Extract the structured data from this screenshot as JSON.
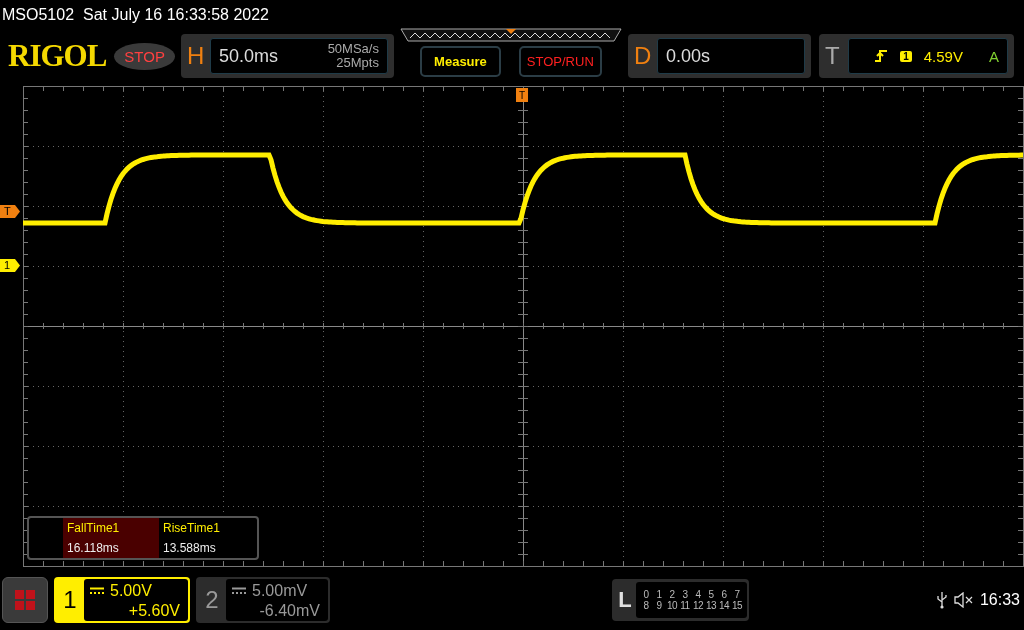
{
  "status_line": {
    "model": "MSO5102",
    "datetime": "Sat July 16 16:33:58 2022"
  },
  "header": {
    "logo": "RIGOL",
    "run_state": "STOP",
    "horizontal": {
      "label": "H",
      "timebase": "50.0ms",
      "sample_rate": "50MSa/s",
      "memory_depth": "25Mpts"
    },
    "buttons": [
      {
        "label": "Measure",
        "kind": "menu"
      },
      {
        "label": "STOP/RUN",
        "kind": "run"
      }
    ],
    "delay": {
      "label": "D",
      "value": "0.00s"
    },
    "trigger": {
      "label": "T",
      "source": "1",
      "level": "4.59V",
      "mode": "A"
    }
  },
  "markers": [
    {
      "text": "T",
      "kind": "trigger"
    },
    {
      "text": "1",
      "kind": "channel"
    }
  ],
  "trigger_position": {
    "text": "T"
  },
  "measurements": [
    {
      "name": "FallTime1",
      "value": "16.118ms",
      "selected": true
    },
    {
      "name": "RiseTime1",
      "value": "13.588ms",
      "selected": false
    }
  ],
  "channels": [
    {
      "number": "1",
      "scale": "5.00V",
      "offset": "+5.60V",
      "on": true
    },
    {
      "number": "2",
      "scale": "5.00mV",
      "offset": "-6.40mV",
      "on": false
    }
  ],
  "logic": {
    "label": "L",
    "rows": [
      [
        "0",
        "1",
        "2",
        "3",
        "4",
        "5",
        "6",
        "7"
      ],
      [
        "8",
        "9",
        "10",
        "11",
        "12",
        "13",
        "14",
        "15"
      ]
    ]
  },
  "clock": "16:33"
}
